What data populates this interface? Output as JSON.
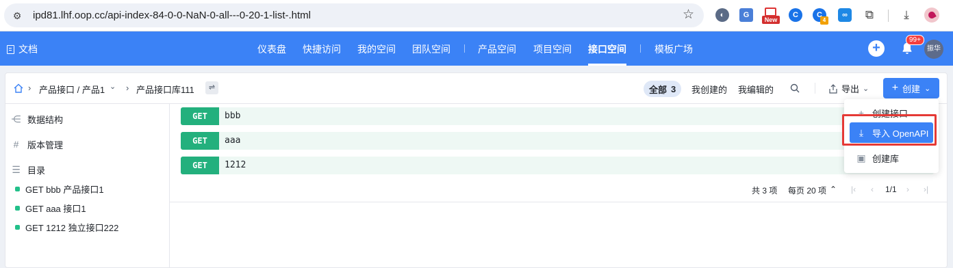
{
  "browser": {
    "url": "ipd81.lhf.oop.cc/api-index-84-0-0-NaN-0-all---0-20-1-list-.html",
    "ext_new_label": "New",
    "ext_badge": "4"
  },
  "topnav": {
    "brand": "文档",
    "links": [
      "仪表盘",
      "快捷访问",
      "我的空间",
      "团队空间",
      "产品空间",
      "项目空间",
      "接口空间",
      "模板广场"
    ],
    "active": "接口空间",
    "notification_count": "99+",
    "user_name": "振华"
  },
  "toolbar": {
    "breadcrumb_product": "产品接口 / 产品1",
    "breadcrumb_lib": "产品接口库111",
    "filter_all": "全部",
    "filter_all_count": "3",
    "filter_mine": "我创建的",
    "filter_edited": "我编辑的",
    "export_label": "导出",
    "create_label": "创建"
  },
  "sidebar": {
    "items": [
      {
        "label": "数据结构",
        "icon": "share-nodes-icon"
      },
      {
        "label": "版本管理",
        "icon": "hash-icon"
      },
      {
        "label": "目录",
        "icon": "list-icon"
      }
    ],
    "tree": [
      "GET bbb 产品接口1",
      "GET aaa 接口1",
      "GET 1212 独立接口222"
    ]
  },
  "apis": [
    {
      "method": "GET",
      "path": "bbb"
    },
    {
      "method": "GET",
      "path": "aaa"
    },
    {
      "method": "GET",
      "path": "1212"
    }
  ],
  "pagination": {
    "total": "共 3 项",
    "per_page": "每页 20 项",
    "page": "1/1"
  },
  "create_menu": {
    "items": [
      {
        "label": "创建接口",
        "icon": "plus-icon"
      },
      {
        "label": "导入 OpenAPI",
        "icon": "import-icon"
      },
      {
        "label": "创建库",
        "icon": "library-icon"
      }
    ],
    "highlighted": "导入 OpenAPI"
  },
  "colors": {
    "primary": "#3b82f6",
    "get_method": "#23b07d",
    "highlight_border": "#e53935"
  }
}
